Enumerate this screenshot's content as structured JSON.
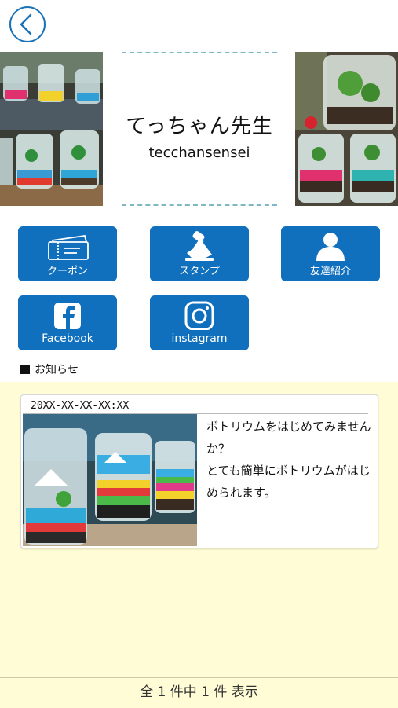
{
  "header": {
    "back_icon": "chevron-left-icon",
    "accent": "#1a73b8"
  },
  "shop": {
    "name": "てっちゃん先生",
    "romanized": "tecchansensei"
  },
  "menu": [
    {
      "label": "クーポン",
      "icon": "ticket-icon"
    },
    {
      "label": "スタンプ",
      "icon": "stamp-icon"
    },
    {
      "label": "友達紹介",
      "icon": "person-icon"
    },
    {
      "label": "Facebook",
      "icon": "facebook-icon"
    },
    {
      "label": "instagram",
      "icon": "instagram-icon"
    }
  ],
  "menu_color": "#1070bd",
  "news": {
    "heading": "お知らせ",
    "items": [
      {
        "date": "20XX-XX-XX-XX:XX",
        "text": "ボトリウムをはじめてみませんか？\nとても簡単にボトリウムがはじめられます。"
      }
    ],
    "background": "#fffcd6"
  },
  "footer": {
    "summary": "全 1 件中 1 件 表示"
  }
}
